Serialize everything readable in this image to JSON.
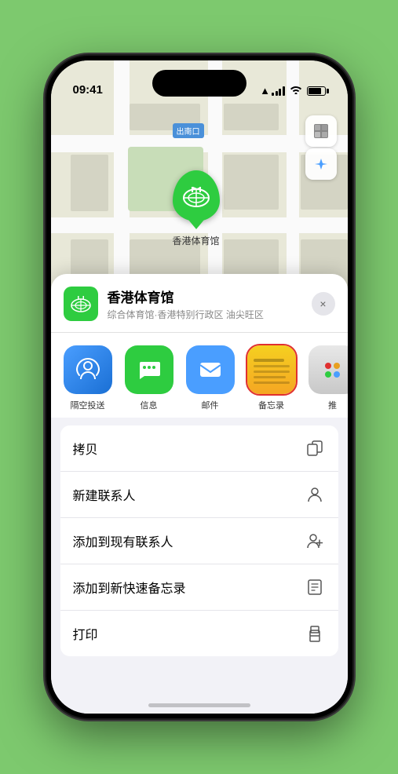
{
  "status": {
    "time": "09:41",
    "time_icon": "location-arrow-icon"
  },
  "map": {
    "label_nankou": "南口",
    "label_nankou_prefix": "出"
  },
  "controls": {
    "map_type_icon": "🗺",
    "location_icon": "➤"
  },
  "pin": {
    "label": "香港体育馆"
  },
  "sheet": {
    "venue_name": "香港体育馆",
    "venue_sub": "综合体育馆·香港特别行政区 油尖旺区",
    "close_label": "×"
  },
  "share_items": [
    {
      "id": "airdrop",
      "label": "隔空投送",
      "bg": "airdrop"
    },
    {
      "id": "message",
      "label": "信息",
      "bg": "message"
    },
    {
      "id": "mail",
      "label": "邮件",
      "bg": "mail"
    },
    {
      "id": "notes",
      "label": "备忘录",
      "bg": "notes",
      "selected": true
    },
    {
      "id": "more",
      "label": "推",
      "bg": "more"
    }
  ],
  "actions": [
    {
      "id": "copy",
      "label": "拷贝",
      "icon": "copy"
    },
    {
      "id": "new-contact",
      "label": "新建联系人",
      "icon": "person"
    },
    {
      "id": "add-existing",
      "label": "添加到现有联系人",
      "icon": "person-add"
    },
    {
      "id": "add-note",
      "label": "添加到新快速备忘录",
      "icon": "note"
    },
    {
      "id": "print",
      "label": "打印",
      "icon": "print"
    }
  ]
}
